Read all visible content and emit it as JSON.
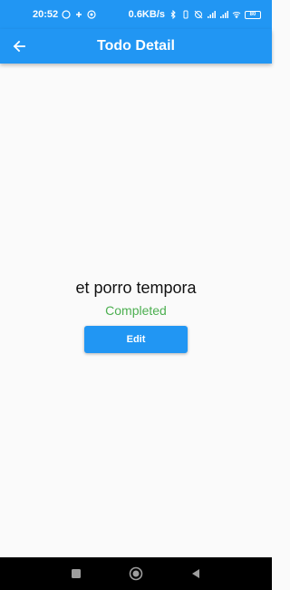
{
  "status_bar": {
    "time": "20:52",
    "network_speed": "0.6KB/s",
    "network_type": "4G",
    "battery": "80"
  },
  "app_bar": {
    "title": "Todo Detail",
    "back_icon": "arrow-back-icon"
  },
  "todo": {
    "title": "et porro tempora",
    "status": "Completed",
    "status_color": "#4caf50"
  },
  "actions": {
    "edit_label": "Edit"
  },
  "colors": {
    "primary": "#2196f3",
    "background": "#fafafa"
  },
  "nav_bar": {
    "icons": [
      "recents-icon",
      "home-icon",
      "back-triangle-icon"
    ]
  }
}
